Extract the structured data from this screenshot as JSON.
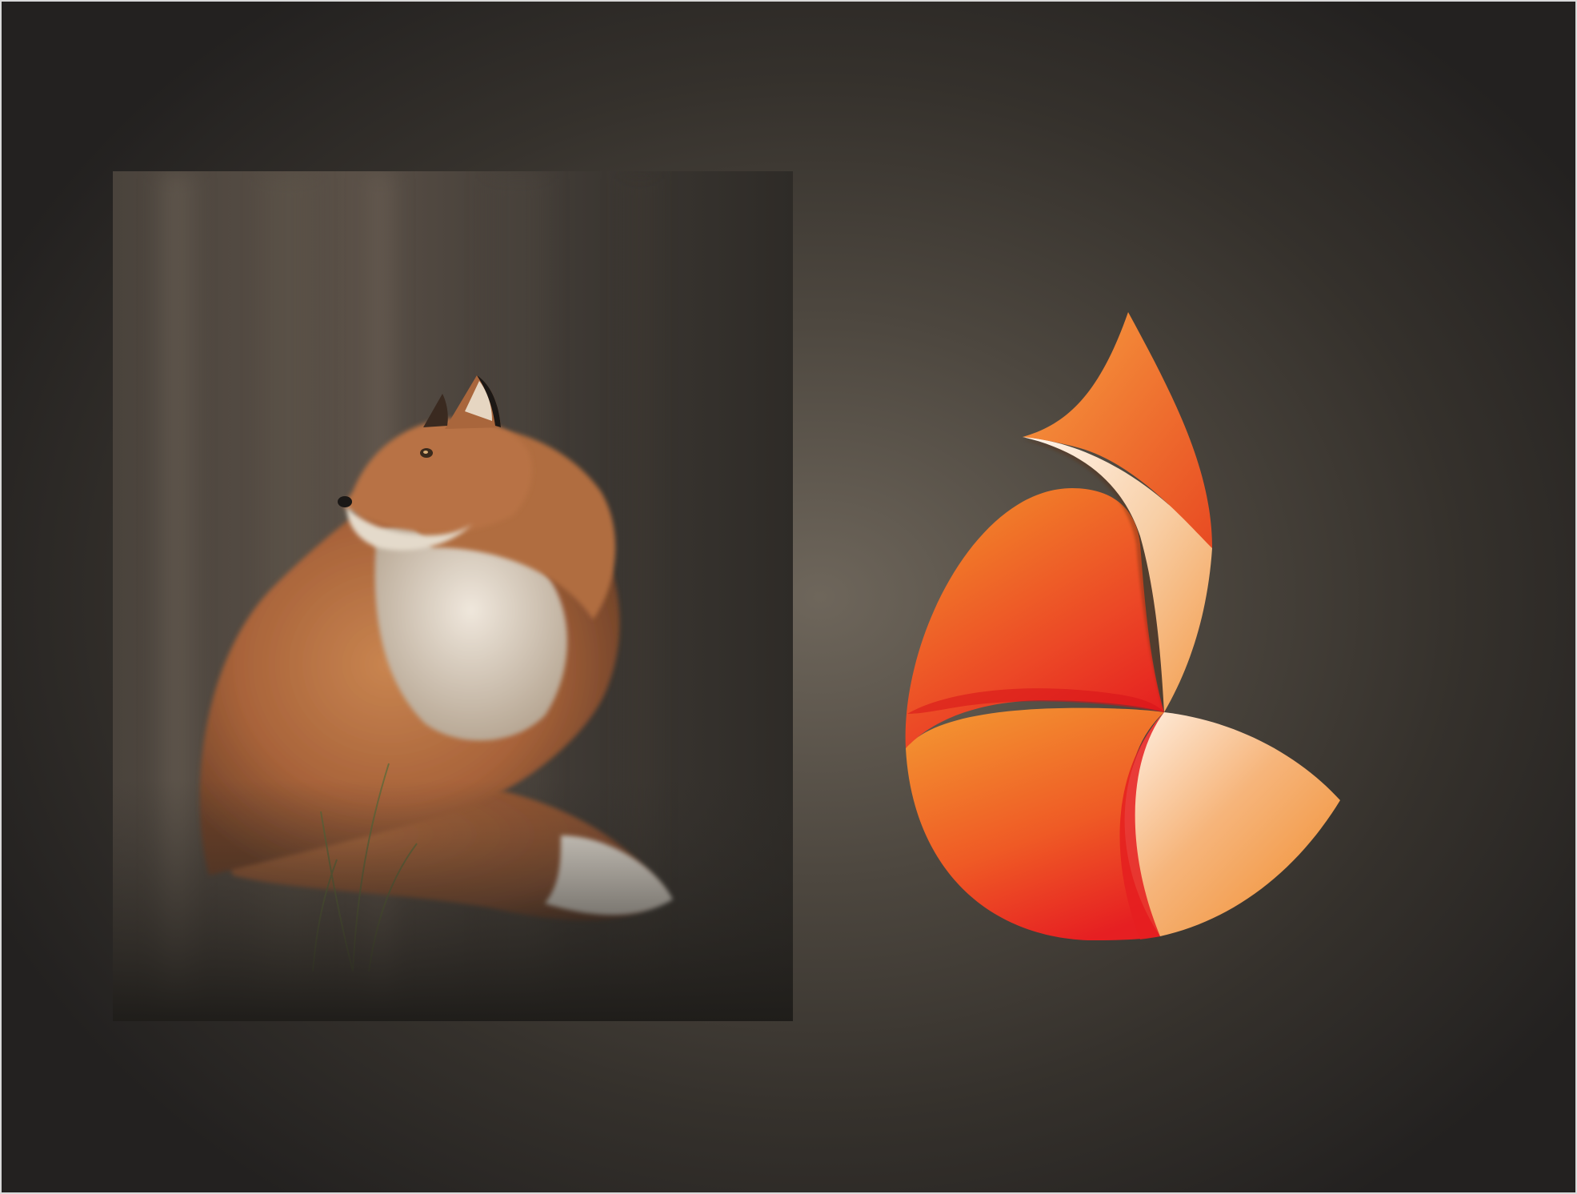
{
  "scene": {
    "background_center": "#6e665b",
    "background_edge": "#232120",
    "border": "#d9d9d9"
  },
  "photo": {
    "subject": "red-fox-portrait",
    "fur": "#b4683a",
    "chest": "#d8cfc2",
    "backdrop": "#3a3530"
  },
  "logo": {
    "colors": {
      "orange": "#f08a2a",
      "red": "#e8211f",
      "peach": "#fbe3cc",
      "light_orange": "#f5a45a"
    }
  }
}
